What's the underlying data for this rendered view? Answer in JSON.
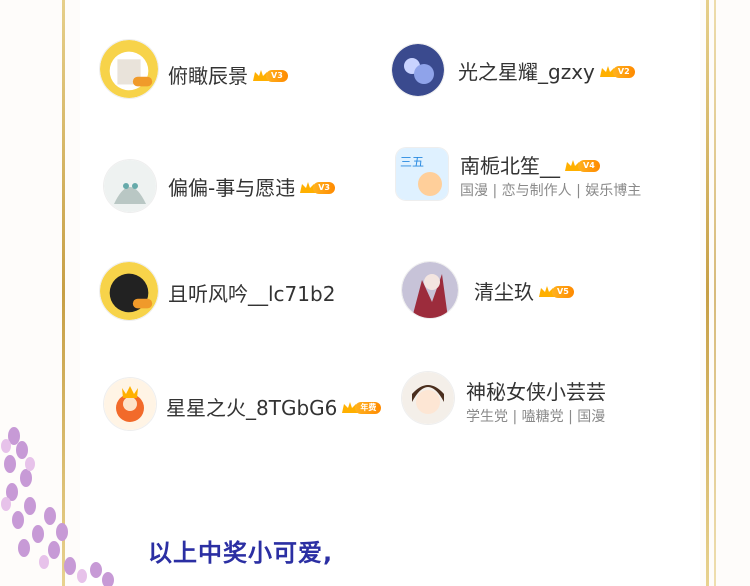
{
  "winners": [
    {
      "name": "俯瞰辰景",
      "level": "V3"
    },
    {
      "name": "光之星耀_gzxy",
      "level": "V2"
    },
    {
      "name": "偏偏-事与愿违",
      "level": "V3"
    },
    {
      "name": "南栀北笙__",
      "level": "V4",
      "tags": "国漫 | 恋与制作人 | 娱乐博主"
    },
    {
      "name": "且听风吟__lc71b2",
      "level": ""
    },
    {
      "name": "清尘玖",
      "level": "V5"
    },
    {
      "name": "星星之火_8TGbG6",
      "level": "年费"
    },
    {
      "name": "神秘女侠小芸芸",
      "level": "",
      "tags": "学生党 | 嗑糖党 | 国漫"
    }
  ],
  "closing_text": "以上中奖小可爱,",
  "colors": {
    "frame": "#d4b060",
    "closing": "#2b2fa3",
    "badge": "#ff9a10"
  }
}
